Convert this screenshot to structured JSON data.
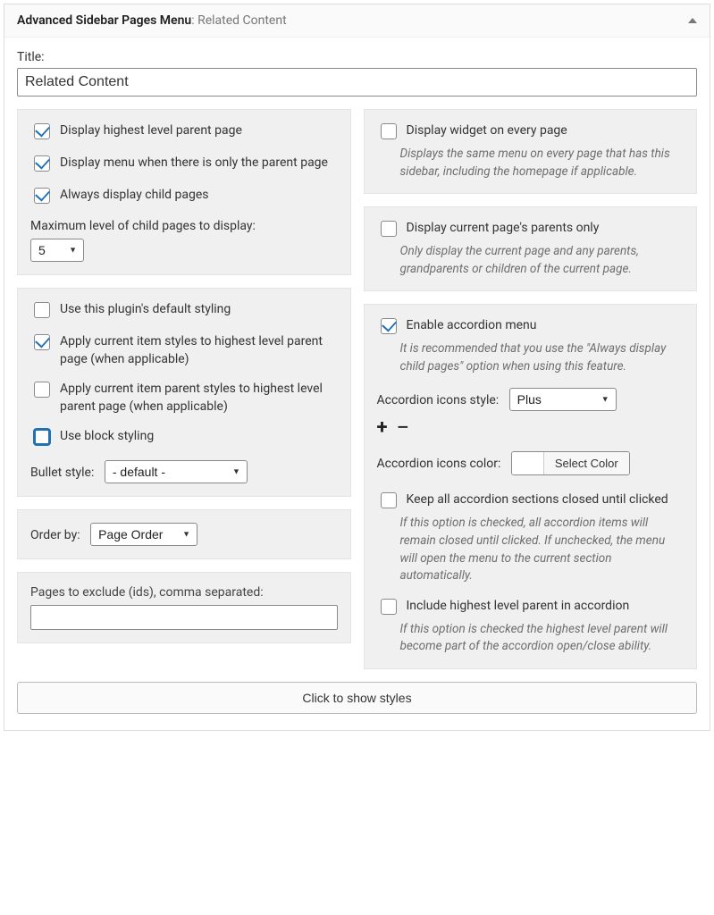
{
  "header": {
    "title": "Advanced Sidebar Pages Menu",
    "subtitle": "Related Content"
  },
  "title": {
    "label": "Title:",
    "value": "Related Content"
  },
  "left": {
    "panel1": {
      "display_highest": "Display highest level parent page",
      "display_menu_only_parent": "Display menu when there is only the parent page",
      "always_display_child": "Always display child pages",
      "max_level_label": "Maximum level of child pages to display:",
      "max_level_value": "5"
    },
    "panel2": {
      "default_styling": "Use this plugin's default styling",
      "apply_current_item": "Apply current item styles to highest level parent page (when applicable)",
      "apply_current_parent": "Apply current item parent styles to highest level parent page (when applicable)",
      "block_styling": "Use block styling",
      "bullet_label": "Bullet style:",
      "bullet_value": "- default -"
    },
    "panel3": {
      "order_label": "Order by:",
      "order_value": "Page Order"
    },
    "panel4": {
      "exclude_label": "Pages to exclude (ids), comma separated:",
      "exclude_value": ""
    }
  },
  "right": {
    "panel1": {
      "every_page": "Display widget on every page",
      "every_page_desc": "Displays the same menu on every page that has this sidebar, including the homepage if applicable."
    },
    "panel2": {
      "parents_only": "Display current page's parents only",
      "parents_only_desc": "Only display the current page and any parents, grandparents or children of the current page."
    },
    "panel3": {
      "enable_accordion": "Enable accordion menu",
      "enable_accordion_desc": "It is recommended that you use the \"Always display child pages\" option when using this feature.",
      "icons_style_label": "Accordion icons style:",
      "icons_style_value": "Plus",
      "icons_color_label": "Accordion icons color:",
      "select_color": "Select Color",
      "keep_closed": "Keep all accordion sections closed until clicked",
      "keep_closed_desc": "If this option is checked, all accordion items will remain closed until clicked. If unchecked, the menu will open the menu to the current section automatically.",
      "include_highest": "Include highest level parent in accordion",
      "include_highest_desc": "If this option is checked the highest level parent will become part of the accordion open/close ability."
    }
  },
  "styles_button": "Click to show styles"
}
